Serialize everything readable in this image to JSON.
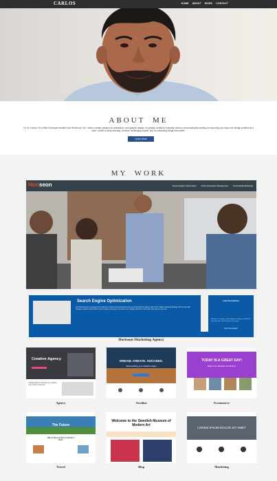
{
  "nav": {
    "brand": "CARLOS",
    "links": [
      "HOME",
      "ABOUT",
      "WORK",
      "CONTACT"
    ]
  },
  "about": {
    "title": "ABOUT ME",
    "text": "Hi, I'm Carlos. I'm a Web Developer student from Richmond, VA. I have a certain passion for animations, and graphic design. I'm greatly confident, naturally curious, and perpetually working on improving my chops one design problem at a time. I prefer to keep learning, continue challenging myself, and do interesting things that matter.",
    "button": "Learn More"
  },
  "work": {
    "title": "MY WORK",
    "featured": {
      "logo_h": "Hori",
      "logo_rest": "seon",
      "nav": [
        "Search Engine Optimization",
        "Online Reputation Management",
        "Social Media Marketing"
      ],
      "box_title": "Search Engine Optimization",
      "box_text": "Our SEO Services is designed for small and medium-sized businesses that need help with the organic side of their digital marketing strategy. We find the right business solutions that work for your company, helping you increase your visibility and drive more traffic and sales to your site.",
      "side_title": "Lead Generation",
      "side_text": "Whether it's Google, or other digital marketing, we'll find the right keywords and strategy for your goals.",
      "side_cta": "Get A Consultation",
      "caption": "Horiseon Marketing Agency"
    },
    "projects": [
      {
        "caption": "Agency",
        "tagline": "Creative Agency",
        "sub": "A digital agency focused on creating your Online presence"
      },
      {
        "caption": "Aeroline",
        "tagline": "DREAM. CREATE. SUCCEED.",
        "sub": "Start building your website today!"
      },
      {
        "caption": "Ecommerce",
        "tagline": "TODAY IS A GREAT DAY!",
        "sub": "Build Your Website with Bulma"
      },
      {
        "caption": "Travel",
        "tagline": "The Future",
        "sub": "We've Re-prioritize to Drink a Beer"
      },
      {
        "caption": "Blog",
        "tagline": "Welcome to the Swedish Museum of Modern Art",
        "sub": ""
      },
      {
        "caption": "Marketing",
        "tagline": "LOREM IPSUM DOLOR SIT AMET",
        "sub": ""
      }
    ]
  },
  "colors": {
    "nav": "#2f2f2f",
    "accent": "#27528f",
    "horiseon_blue": "#0b5aa8",
    "horiseon_orange": "#e8491d"
  }
}
